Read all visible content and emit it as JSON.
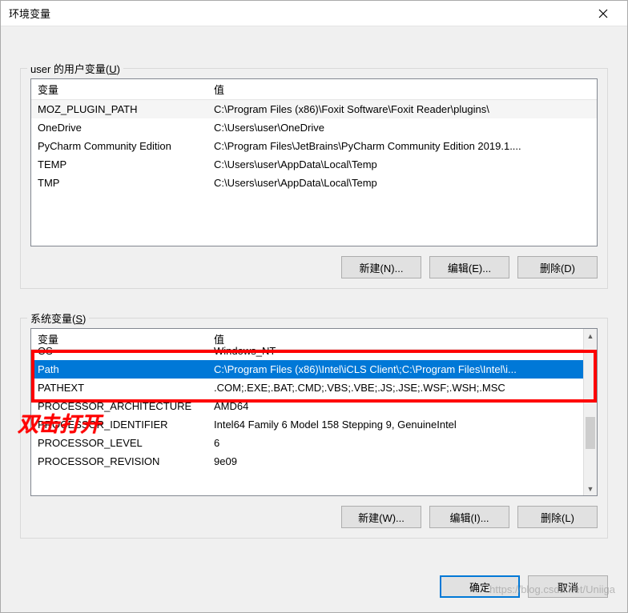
{
  "window": {
    "title": "环境变量"
  },
  "user_section": {
    "label_prefix": "user 的用户变量(",
    "label_hotkey": "U",
    "label_suffix": ")",
    "columns": {
      "var": "变量",
      "val": "值"
    },
    "rows": [
      {
        "var": "MOZ_PLUGIN_PATH",
        "val": "C:\\Program Files (x86)\\Foxit Software\\Foxit Reader\\plugins\\"
      },
      {
        "var": "OneDrive",
        "val": "C:\\Users\\user\\OneDrive"
      },
      {
        "var": "PyCharm Community Edition",
        "val": "C:\\Program Files\\JetBrains\\PyCharm Community Edition 2019.1...."
      },
      {
        "var": "TEMP",
        "val": "C:\\Users\\user\\AppData\\Local\\Temp"
      },
      {
        "var": "TMP",
        "val": "C:\\Users\\user\\AppData\\Local\\Temp"
      }
    ],
    "buttons": {
      "new": "新建(N)...",
      "edit": "编辑(E)...",
      "delete": "删除(D)"
    }
  },
  "system_section": {
    "label_prefix": "系统变量(",
    "label_hotkey": "S",
    "label_suffix": ")",
    "columns": {
      "var": "变量",
      "val": "值"
    },
    "rows": [
      {
        "var": "OS",
        "val": "Windows_NT"
      },
      {
        "var": "Path",
        "val": "C:\\Program Files (x86)\\Intel\\iCLS Client\\;C:\\Program Files\\Intel\\i...",
        "selected": true
      },
      {
        "var": "PATHEXT",
        "val": ".COM;.EXE;.BAT;.CMD;.VBS;.VBE;.JS;.JSE;.WSF;.WSH;.MSC"
      },
      {
        "var": "PROCESSOR_ARCHITECTURE",
        "val": "AMD64"
      },
      {
        "var": "PROCESSOR_IDENTIFIER",
        "val": "Intel64 Family 6 Model 158 Stepping 9, GenuineIntel"
      },
      {
        "var": "PROCESSOR_LEVEL",
        "val": "6"
      },
      {
        "var": "PROCESSOR_REVISION",
        "val": "9e09"
      }
    ],
    "buttons": {
      "new": "新建(W)...",
      "edit": "编辑(I)...",
      "delete": "删除(L)"
    }
  },
  "dialog_buttons": {
    "ok": "确定",
    "cancel": "取消"
  },
  "annotation": {
    "text": "双击打开"
  },
  "watermark": "https://blog.csdn.net/Uniiga"
}
